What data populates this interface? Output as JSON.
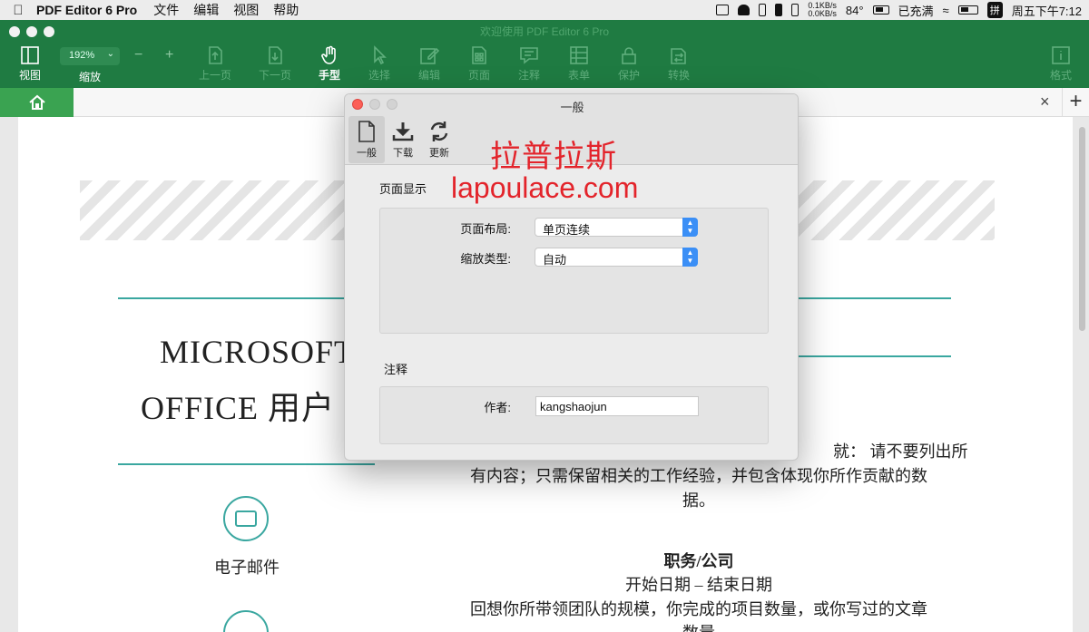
{
  "menubar": {
    "app_name": "PDF Editor 6 Pro",
    "items": [
      "文件",
      "编辑",
      "视图",
      "帮助"
    ],
    "net_up": "0.1KB/s",
    "net_down": "0.0KB/s",
    "temperature": "84°",
    "battery_status": "已充满",
    "ime": "拼",
    "clock": "周五下午7:12"
  },
  "toolbar": {
    "window_title": "欢迎使用 PDF Editor 6 Pro",
    "view_label": "视图",
    "zoom_value": "192%",
    "zoom_label": "缩放",
    "zoom_minus": "−",
    "zoom_plus": "+",
    "prev_page_label": "上一页",
    "next_page_label": "下一页",
    "hand_label": "手型",
    "select_label": "选择",
    "edit_label": "编辑",
    "page_label": "页面",
    "annotate_label": "注释",
    "form_label": "表单",
    "protect_label": "保护",
    "convert_label": "转换",
    "format_label": "格式"
  },
  "tabbar": {
    "close": "×",
    "add": "+"
  },
  "document": {
    "title_line1": "MICROSOFT",
    "title_line2": "OFFICE 用户",
    "text_frag": "就： 请不要列出所",
    "para1_line2": "有内容；只需保留相关的工作经验，并包含体现你所作贡献的数",
    "para1_line3": "据。",
    "email_label": "电子邮件",
    "job_title": "职务/公司",
    "dates": "开始日期 – 结束日期",
    "para2_line1": "回想你所带领团队的规模，你完成的项目数量，或你写过的文章",
    "para2_line2": "数量"
  },
  "watermark": {
    "cn": "拉普拉斯",
    "en": "lapoulace.com"
  },
  "dialog": {
    "title": "一般",
    "tabs": {
      "general": "一般",
      "download": "下载",
      "update": "更新"
    },
    "page_display_section": "页面显示",
    "page_layout_label": "页面布局:",
    "page_layout_value": "单页连续",
    "zoom_type_label": "缩放类型:",
    "zoom_type_value": "自动",
    "annotation_section": "注释",
    "author_label": "作者:",
    "author_value": "kangshaojun"
  },
  "colors": {
    "toolbar_green": "#1f7b42",
    "home_tab_green": "#3aa351",
    "teal_accent": "#3aa7a0",
    "watermark_red": "#e3242b",
    "select_blue": "#3b8ff6"
  }
}
